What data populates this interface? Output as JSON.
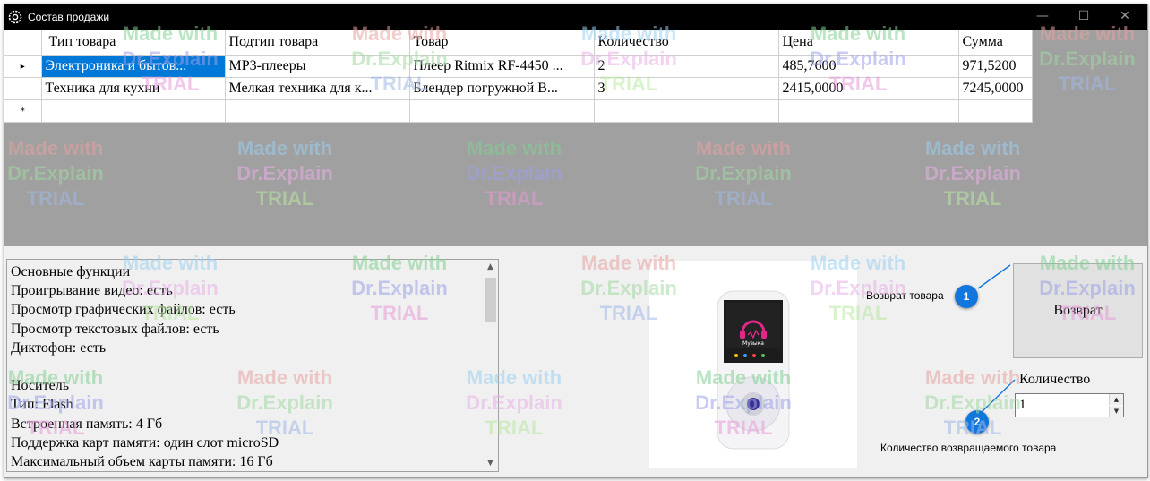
{
  "window": {
    "title": "Состав продажи",
    "app_icon": "gear-icon",
    "controls": {
      "minimize": "—",
      "maximize": "☐",
      "close": "✕"
    }
  },
  "grid": {
    "columns": [
      "Тип товара",
      "Подтип товара",
      "Товар",
      "Количество",
      "Цена",
      "Сумма"
    ],
    "rows": [
      {
        "marker": "▸",
        "cells": [
          "Электроника и бытов...",
          "MP3-плееры",
          "Плеер Ritmix RF-4450 ...",
          "2",
          "485,7600",
          "971,5200"
        ],
        "selected_cell": 0
      },
      {
        "marker": "",
        "cells": [
          "Техника для кухни",
          "Мелкая техника для к...",
          "Блендер погружной В...",
          "3",
          "2415,0000",
          "7245,0000"
        ]
      }
    ],
    "new_row_marker": "*",
    "selection_color": "#0078d7",
    "empty_area_color": "#a0a0a0"
  },
  "description": {
    "lines": [
      "Основные функции",
      "Проигрывание видео: есть",
      "Просмотр графических файлов: есть",
      "Просмотр текстовых файлов: есть",
      "Диктофон: есть",
      "",
      "Носитель",
      "Тип: Flash",
      "Встроенная память: 4 Гб",
      "Поддержка карт памяти: один слот microSD",
      "Максимальный объем карты памяти: 16 Гб"
    ]
  },
  "product_image": {
    "screen_label": "Музыка",
    "accent": "#e0288a"
  },
  "return": {
    "label": "Возврат товара",
    "button_label": "Возврат"
  },
  "quantity": {
    "label": "Количество",
    "value": "1",
    "caption": "Количество возвращаемого товара"
  },
  "callouts": {
    "one": "1",
    "two": "2",
    "color": "#1177dd"
  },
  "watermark": {
    "line1": "Made with",
    "line2": "Dr.Explain",
    "line3": "TRIAL"
  }
}
